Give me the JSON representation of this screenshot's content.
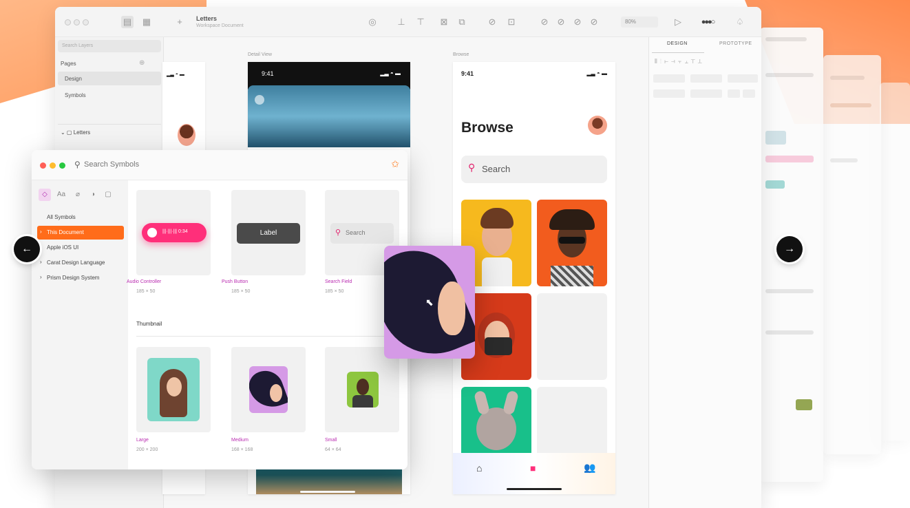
{
  "toolbar": {
    "doc_title": "Letters",
    "doc_subtitle": "Workspace Document",
    "zoom": "80%"
  },
  "layers": {
    "search_placeholder": "Search Layers",
    "pages_label": "Pages",
    "pages": [
      "Design",
      "Symbols"
    ],
    "current_layer": "Letters"
  },
  "canvas": {
    "detail_view_label": "Detail View",
    "browse_label": "Browse",
    "time": "9:41",
    "browse_title": "Browse",
    "search_placeholder": "Search"
  },
  "inspector": {
    "tabs": [
      "DESIGN",
      "PROTOTYPE"
    ]
  },
  "symbols_panel": {
    "search_placeholder": "Search Symbols",
    "nav": [
      "All Symbols",
      "This Document",
      "Apple iOS UI",
      "Carat Design Language",
      "Prism Design System"
    ],
    "cards": [
      {
        "name": "Audio Controller",
        "size": "185 × 50",
        "preview_text": "0:34"
      },
      {
        "name": "Push Button",
        "size": "185 × 50",
        "preview_text": "Label"
      },
      {
        "name": "Search Field",
        "size": "185 × 50",
        "preview_text": "Search"
      }
    ],
    "section_title": "Thumbnail",
    "thumbnails": [
      {
        "name": "Large",
        "size": "200 × 200"
      },
      {
        "name": "Medium",
        "size": "168 × 168"
      },
      {
        "name": "Small",
        "size": "64 × 64"
      }
    ]
  },
  "colors": {
    "accent_orange": "#ff6c1a",
    "accent_pink": "#ff2f7a",
    "symbol_name_purple": "#b92bb0"
  },
  "icons": [
    "search-icon",
    "pin-icon",
    "arrow-left-icon",
    "arrow-right-icon",
    "home-icon",
    "grid-icon",
    "people-icon"
  ]
}
